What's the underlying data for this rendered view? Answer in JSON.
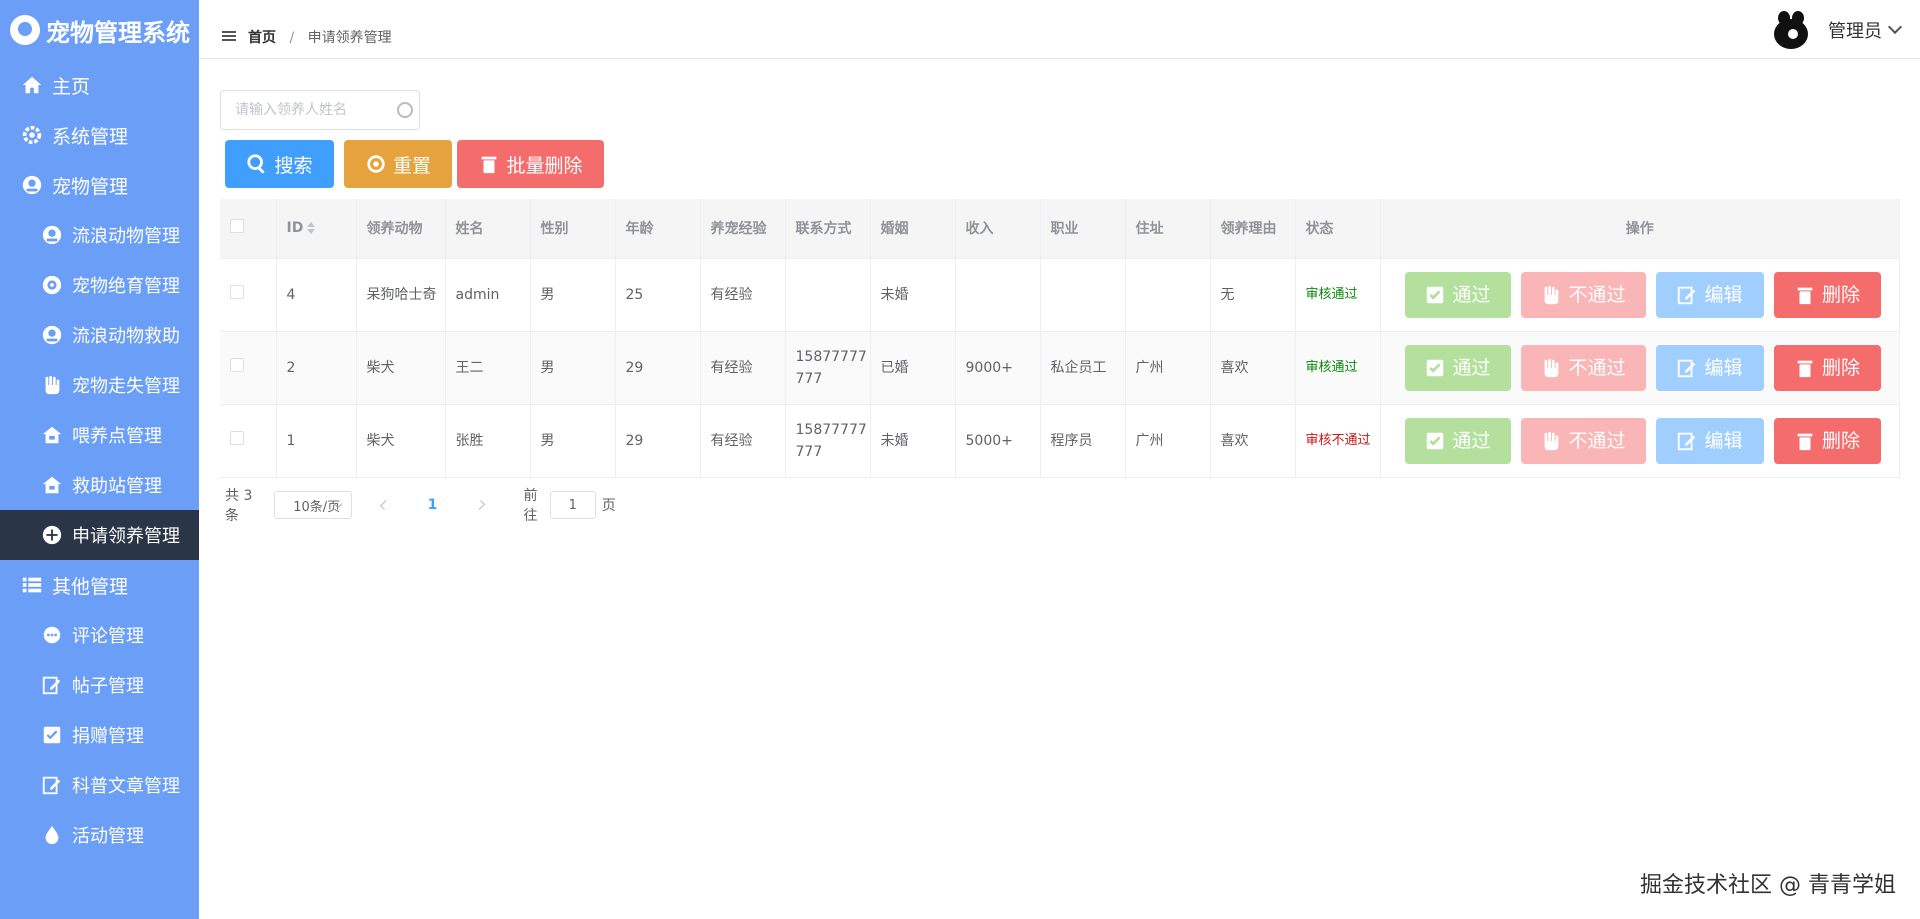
{
  "app": {
    "title": "宠物管理系统"
  },
  "sidebar": {
    "items": [
      {
        "label": "主页",
        "icon": "home-icon",
        "sub": false
      },
      {
        "label": "系统管理",
        "icon": "gear-icon",
        "sub": false
      },
      {
        "label": "宠物管理",
        "icon": "pet-icon",
        "sub": false
      },
      {
        "label": "流浪动物管理",
        "icon": "pet-icon",
        "sub": true
      },
      {
        "label": "宠物绝育管理",
        "icon": "target-icon",
        "sub": true
      },
      {
        "label": "流浪动物救助",
        "icon": "pet-icon",
        "sub": true
      },
      {
        "label": "宠物走失管理",
        "icon": "hand-icon",
        "sub": true
      },
      {
        "label": "喂养点管理",
        "icon": "house-icon",
        "sub": true
      },
      {
        "label": "救助站管理",
        "icon": "house-icon",
        "sub": true
      },
      {
        "label": "申请领养管理",
        "icon": "plus-circle-icon",
        "sub": true,
        "active": true
      },
      {
        "label": "其他管理",
        "icon": "list-icon",
        "sub": false
      },
      {
        "label": "评论管理",
        "icon": "comment-icon",
        "sub": true
      },
      {
        "label": "帖子管理",
        "icon": "edit-icon",
        "sub": true
      },
      {
        "label": "捐赠管理",
        "icon": "check-box-icon",
        "sub": true
      },
      {
        "label": "科普文章管理",
        "icon": "edit-icon",
        "sub": true
      },
      {
        "label": "活动管理",
        "icon": "drop-icon",
        "sub": true
      }
    ]
  },
  "header": {
    "breadcrumb_home": "首页",
    "breadcrumb_sep": "/",
    "breadcrumb_current": "申请领养管理",
    "user_name": "管理员"
  },
  "search": {
    "placeholder": "请输入领养人姓名"
  },
  "toolbar": {
    "search_label": "搜索",
    "reset_label": "重置",
    "batch_delete_label": "批量删除"
  },
  "table": {
    "headers": [
      "ID",
      "领养动物",
      "姓名",
      "性别",
      "年龄",
      "养宠经验",
      "联系方式",
      "婚姻",
      "收入",
      "职业",
      "住址",
      "领养理由",
      "状态",
      "操作"
    ],
    "rows": [
      {
        "id": "4",
        "animal": "呆狗哈士奇",
        "name": "admin",
        "gender": "男",
        "age": "25",
        "exp": "有经验",
        "contact": "",
        "marriage": "未婚",
        "income": "",
        "job": "",
        "address": "",
        "reason": "无",
        "status": "审核通过",
        "status_type": "ok"
      },
      {
        "id": "2",
        "animal": "柴犬",
        "name": "王二",
        "gender": "男",
        "age": "29",
        "exp": "有经验",
        "contact": "15877777777",
        "marriage": "已婚",
        "income": "9000+",
        "job": "私企员工",
        "address": "广州",
        "reason": "喜欢",
        "status": "审核通过",
        "status_type": "ok"
      },
      {
        "id": "1",
        "animal": "柴犬",
        "name": "张胜",
        "gender": "男",
        "age": "29",
        "exp": "有经验",
        "contact": "15877777777",
        "marriage": "未婚",
        "income": "5000+",
        "job": "程序员",
        "address": "广州",
        "reason": "喜欢",
        "status": "审核不通过",
        "status_type": "no"
      }
    ],
    "ops": {
      "pass": "通过",
      "fail": "不通过",
      "edit": "编辑",
      "delete": "删除"
    }
  },
  "pagination": {
    "total": "共 3 条",
    "page_size": "10条/页",
    "current": "1",
    "goto_label": "前往",
    "goto_value": "1",
    "page_label": "页"
  },
  "footer": {
    "credit": "掘金技术社区 @ 青青学姐"
  },
  "colors": {
    "sidebar_bg": "#6b9ef7",
    "active_bg": "#2a3547",
    "primary": "#409eff",
    "warning": "#e6a23c",
    "danger": "#f56c6c",
    "success_light": "#b3e19d"
  }
}
